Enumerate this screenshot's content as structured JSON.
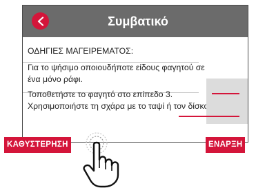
{
  "header": {
    "title": "Συμβατικό",
    "back_icon": "chevron-left-icon"
  },
  "content": {
    "heading": "ΟΔΗΓΙΕΣ ΜΑΓΕΙΡΕΜΑΤΟΣ:",
    "para1": "Για το ψήσιμο οποιουδήποτε είδους φαγητού σε ένα μόνο ράφι.",
    "para2": "Τοποθετήστε το φαγητό στο επίπεδο 3. Χρησιμοποιήστε τη σχάρα με το ταψί ή τον δίσκο."
  },
  "buttons": {
    "delay_label": "ΚΑΘΥΣΤΕΡΗΣΗ",
    "start_label": "ΕΝΑΡΞΗ"
  },
  "colors": {
    "accent": "#d4153a",
    "header_bg": "#6b6b6b",
    "rack_panel": "#dcdcdc"
  },
  "icons": {
    "pointer": "tap-hand-icon",
    "rack": "oven-rack-icon"
  }
}
